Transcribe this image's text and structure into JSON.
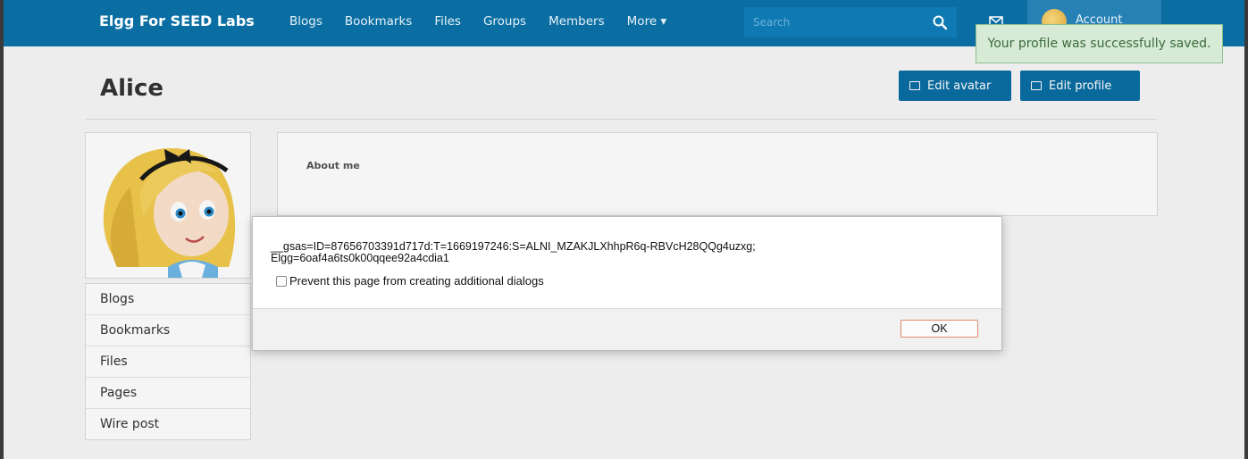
{
  "header": {
    "site_title": "Elgg For SEED Labs",
    "nav": [
      "Blogs",
      "Bookmarks",
      "Files",
      "Groups",
      "Members",
      "More ▾"
    ],
    "search_placeholder": "Search",
    "account_label": "Account"
  },
  "toast": {
    "message": "Your profile was successfully saved."
  },
  "profile": {
    "name": "Alice",
    "edit_avatar_label": "Edit avatar",
    "edit_profile_label": "Edit profile",
    "about_label": "About me"
  },
  "sidebar": {
    "items": [
      "Blogs",
      "Bookmarks",
      "Files",
      "Pages",
      "Wire post"
    ]
  },
  "dialog": {
    "message_line1": "__gsas=ID=87656703391d717d:T=1669197246:S=ALNI_MZAKJLXhhpR6q-RBVcH28QQg4uzxg;",
    "message_line2": "Elgg=6oaf4a6ts0k00qqee92a4cdia1",
    "prevent_label": "Prevent this page from creating additional dialogs",
    "ok_label": "OK"
  },
  "colors": {
    "topbar": "#0b6ea3",
    "button": "#0b6ea3",
    "toast_bg": "#d6ead6",
    "toast_text": "#3b6b3b"
  }
}
